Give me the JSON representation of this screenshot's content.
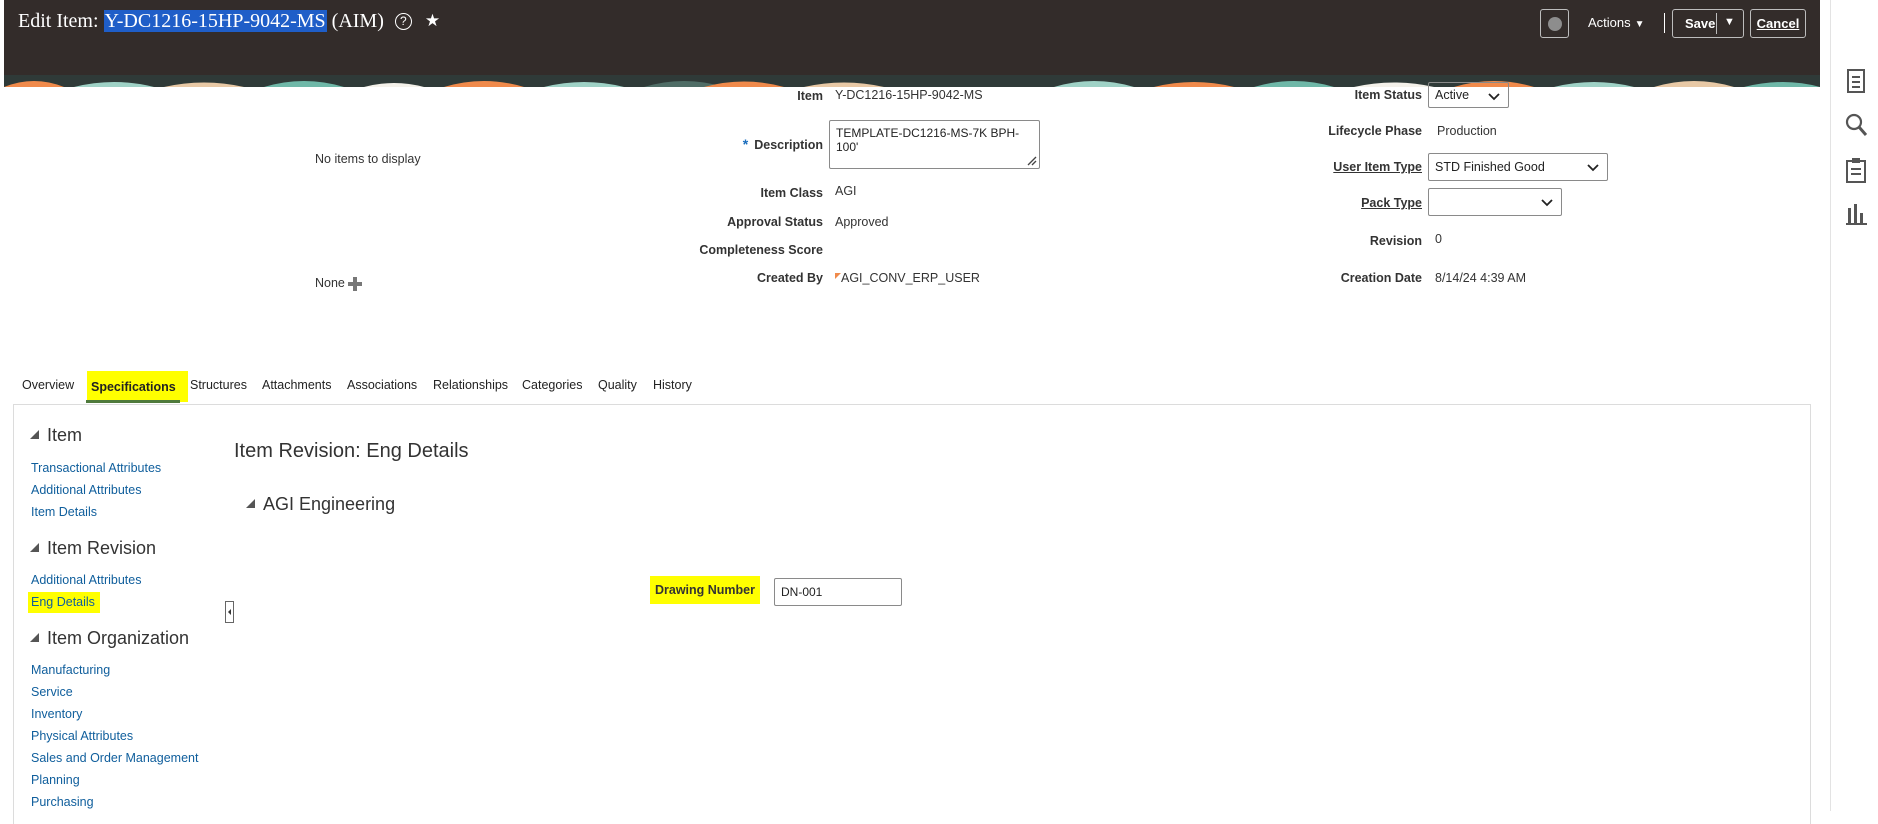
{
  "header": {
    "title_prefix": "Edit Item:",
    "item_code": "Y-DC1216-15HP-9042-MS",
    "title_suffix": "(AIM)",
    "help_glyph": "?",
    "star_glyph": "★",
    "actions_label": "Actions",
    "save_label": "Save",
    "cancel_label": "Cancel"
  },
  "summary": {
    "no_items": "No items to display",
    "none_label": "None",
    "item_label": "Item",
    "item_value": "Y-DC1216-15HP-9042-MS",
    "description_label": "Description",
    "description_value": "TEMPLATE-DC1216-MS-7K BPH-100'",
    "item_class_label": "Item Class",
    "item_class_value": "AGI",
    "approval_status_label": "Approval Status",
    "approval_status_value": "Approved",
    "completeness_label": "Completeness Score",
    "created_by_label": "Created By",
    "created_by_value": "AGI_CONV_ERP_USER",
    "item_status_label": "Item Status",
    "item_status_value": "Active",
    "lifecycle_label": "Lifecycle Phase",
    "lifecycle_value": "Production",
    "user_item_type_label": "User Item Type",
    "user_item_type_value": "STD Finished Good",
    "pack_type_label": "Pack Type",
    "pack_type_value": "",
    "revision_label": "Revision",
    "revision_value": "0",
    "creation_date_label": "Creation Date",
    "creation_date_value": "8/14/24 4:39 AM"
  },
  "tabs": [
    {
      "label": "Overview"
    },
    {
      "label": "Specifications"
    },
    {
      "label": "Structures"
    },
    {
      "label": "Attachments"
    },
    {
      "label": "Associations"
    },
    {
      "label": "Relationships"
    },
    {
      "label": "Categories"
    },
    {
      "label": "Quality"
    },
    {
      "label": "History"
    }
  ],
  "left_nav": {
    "item_header": "Item",
    "item_links": [
      "Transactional Attributes",
      "Additional Attributes",
      "Item Details"
    ],
    "revision_header": "Item Revision",
    "revision_links": [
      "Additional Attributes",
      "Eng Details"
    ],
    "org_header": "Item Organization",
    "org_links": [
      "Manufacturing",
      "Service",
      "Inventory",
      "Physical Attributes",
      "Sales and Order Management",
      "Planning",
      "Purchasing"
    ]
  },
  "content": {
    "page_title": "Item Revision: Eng Details",
    "group_title": "AGI Engineering",
    "drawing_number_label": "Drawing Number",
    "drawing_number_value": "DN-001"
  },
  "icons": {
    "rail": [
      "document-icon",
      "search-icon",
      "clipboard-icon",
      "bar-chart-icon"
    ],
    "globe": "globe-icon",
    "plus": "plus-icon"
  },
  "colors": {
    "header_bg": "#332c2a",
    "highlight": "#ffff00",
    "link": "#0f5e9c",
    "selection": "#1f5ec8"
  }
}
